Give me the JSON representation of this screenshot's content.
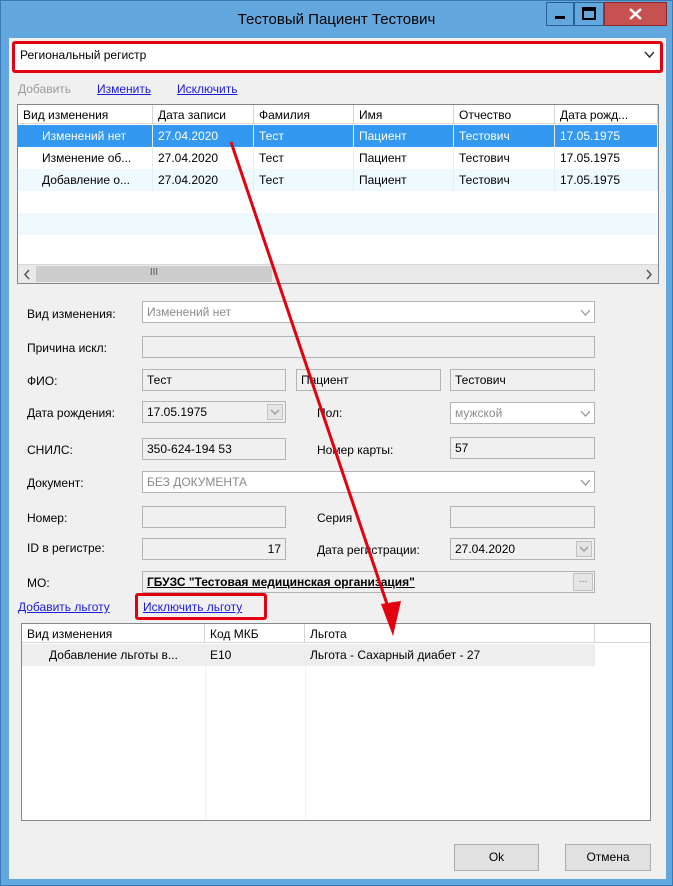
{
  "window": {
    "title": "Тестовый Пациент Тестович",
    "minimize_icon": "minimize-icon",
    "maximize_icon": "maximize-icon",
    "close_icon": "close-icon"
  },
  "register_select": {
    "value": "Региональный регистр",
    "icon": "chevron-down-icon"
  },
  "actions": {
    "add": "Добавить",
    "edit": "Изменить",
    "exclude": "Исключить"
  },
  "history_table": {
    "columns": [
      "Вид изменения",
      "Дата записи",
      "Фамилия",
      "Имя",
      "Отчество",
      "Дата рожд..."
    ],
    "rows": [
      [
        "Изменений нет",
        "27.04.2020",
        "Тест",
        "Пациент",
        "Тестович",
        "17.05.1975"
      ],
      [
        "Изменение об...",
        "27.04.2020",
        "Тест",
        "Пациент",
        "Тестович",
        "17.05.1975"
      ],
      [
        "Добавление о...",
        "27.04.2020",
        "Тест",
        "Пациент",
        "Тестович",
        "17.05.1975"
      ]
    ],
    "selected_row": 0,
    "scroll_left_icon": "chevron-left-icon",
    "scroll_right_icon": "chevron-right-icon",
    "scroll_grip": "III"
  },
  "form": {
    "change_type_label": "Вид изменения:",
    "change_type_value": "Изменений нет",
    "reason_label": "Причина искл:",
    "reason_value": "",
    "fio_label": "ФИО:",
    "last_name": "Тест",
    "first_name": "Пациент",
    "middle_name": "Тестович",
    "birth_label": "Дата рождения:",
    "birth_value": "17.05.1975",
    "sex_label": "Пол:",
    "sex_value": "мужской",
    "snils_label": "СНИЛС:",
    "snils_value": "350-624-194 53",
    "card_label": "Номер карты:",
    "card_value": "57",
    "doc_label": "Документ:",
    "doc_value": "БЕЗ ДОКУМЕНТА",
    "number_label": "Номер:",
    "number_value": "",
    "series_label": "Серия",
    "series_value": "",
    "regid_label": "ID в регистре:",
    "regid_value": "17",
    "regdate_label": "Дата регистрации:",
    "regdate_value": "27.04.2020",
    "mo_label": "МО:",
    "mo_value": "ГБУЗС \"Тестовая медицинская организация\"",
    "mo_button": "..."
  },
  "benefit_actions": {
    "add": "Добавить льготу",
    "exclude": "Исключить льготу"
  },
  "benefit_table": {
    "columns": [
      "Вид изменения",
      "Код МКБ",
      "Льгота"
    ],
    "rows": [
      [
        "Добавление льготы в...",
        "E10",
        "Льгота - Сахарный диабет - 27"
      ]
    ]
  },
  "buttons": {
    "ok": "Ok",
    "cancel": "Отмена"
  },
  "colors": {
    "highlight_frame": "#e3000f",
    "selection": "#3398f0",
    "link": "#1a1ae0"
  }
}
